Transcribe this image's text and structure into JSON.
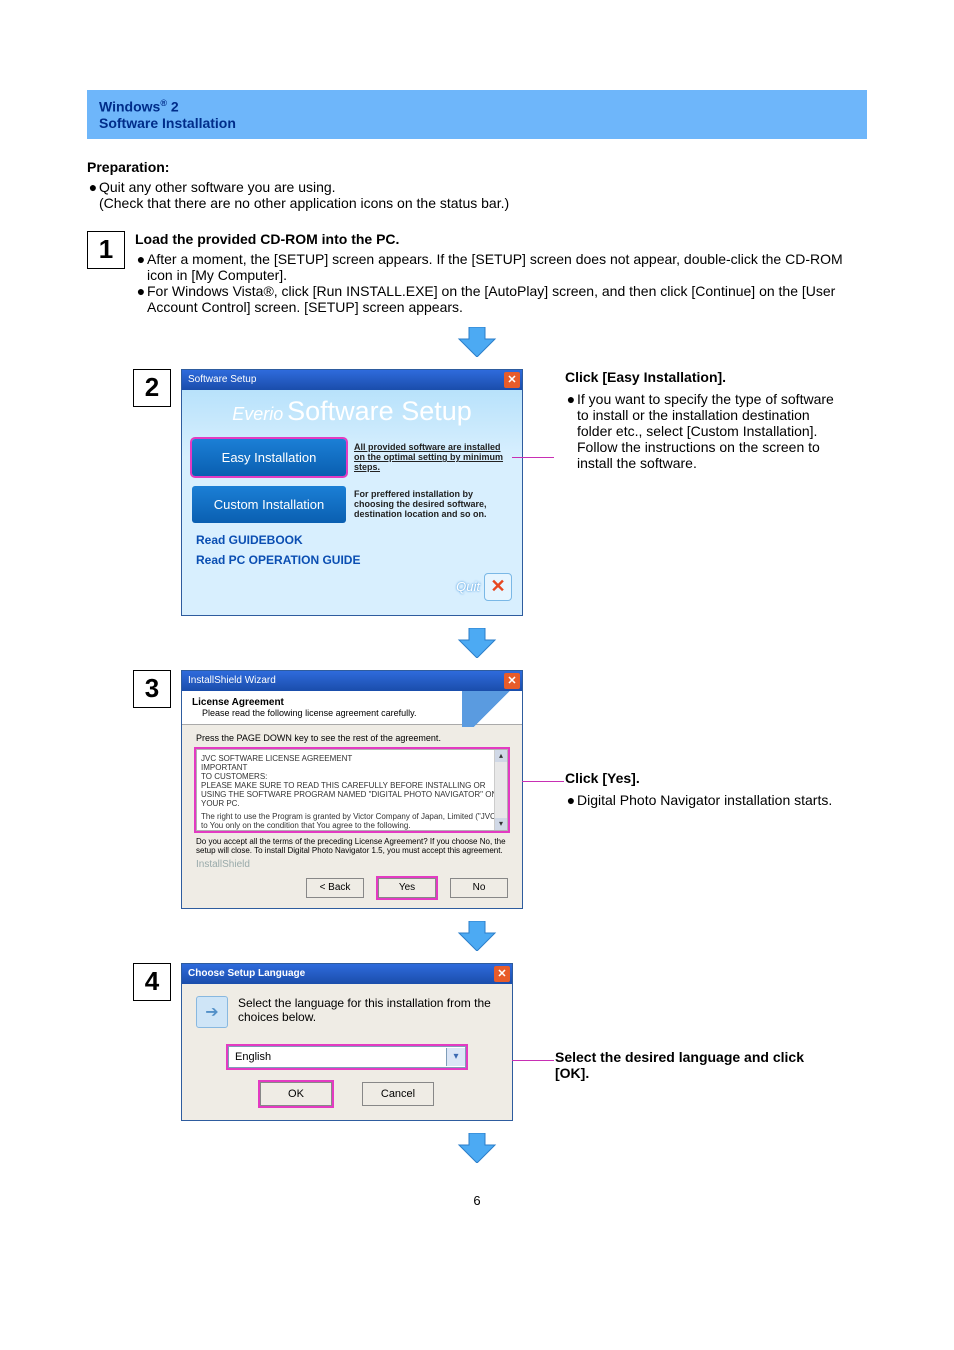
{
  "header": {
    "line1_pre": "Windows",
    "line1_reg": "®",
    "line1_post": " 2",
    "line2": "Software Installation"
  },
  "prep": {
    "title": "Preparation:",
    "b1": "Quit any other software you are using.",
    "b1_sub": "(Check that there are no other application icons on the status bar.)"
  },
  "step1": {
    "num": "1",
    "heading": "Load the provided CD-ROM into the PC.",
    "b1": "After a moment, the [SETUP] screen appears. If the [SETUP] screen does not appear, double-click the CD-ROM icon in [My Computer].",
    "b2": "For Windows Vista®, click [Run INSTALL.EXE] on the [AutoPlay] screen, and then click [Continue] on the [User Account Control] screen. [SETUP] screen appears."
  },
  "step2": {
    "num": "2",
    "titlebar": "Software Setup",
    "brand_small": "Everio",
    "brand_big": "Software Setup",
    "easy_btn": "Easy Installation",
    "easy_desc": "All provided software are installed on the optimal setting by minimum steps.",
    "custom_btn": "Custom Installation",
    "custom_desc": "For preffered installation by choosing the desired software, destination location and so on.",
    "read_guide": "Read GUIDEBOOK",
    "read_pc": "Read PC OPERATION GUIDE",
    "quit": "Quit",
    "side_title": "Click [Easy Installation].",
    "side_b1": "If you want to specify the type of software to install or the installation destination folder etc., select [Custom Installation].",
    "side_b1b": "Follow the instructions on the screen to install the software."
  },
  "step3": {
    "num": "3",
    "titlebar": "InstallShield Wizard",
    "hd_title": "License Agreement",
    "hd_sub": "Please read the following license agreement carefully.",
    "instr": "Press the PAGE DOWN key to see the rest of the agreement.",
    "lic_l1": "JVC SOFTWARE LICENSE AGREEMENT",
    "lic_l2": "IMPORTANT",
    "lic_l3": "TO CUSTOMERS:",
    "lic_l4": "PLEASE MAKE SURE TO READ THIS CAREFULLY BEFORE INSTALLING OR USING THE SOFTWARE PROGRAM NAMED \"DIGITAL PHOTO NAVIGATOR\" ON YOUR PC.",
    "lic_l5": "The right to use the Program is granted by Victor Company of Japan, Limited (\"JVC\") to You only on the condition that You agree to the following.",
    "accept": "Do you accept all the terms of the preceding License Agreement?  If you choose No,  the setup will close.  To install Digital Photo Navigator 1.5, you must accept this agreement.",
    "brand": "InstallShield",
    "btn_back": "< Back",
    "btn_yes": "Yes",
    "btn_no": "No",
    "side_title": "Click [Yes].",
    "side_b1": "Digital Photo Navigator installation starts."
  },
  "step4": {
    "num": "4",
    "titlebar": "Choose Setup Language",
    "msg": "Select the language for this installation from the choices below.",
    "selected": "English",
    "btn_ok": "OK",
    "btn_cancel": "Cancel",
    "side_title": "Select the desired language and click [OK]."
  },
  "page_num": "6"
}
